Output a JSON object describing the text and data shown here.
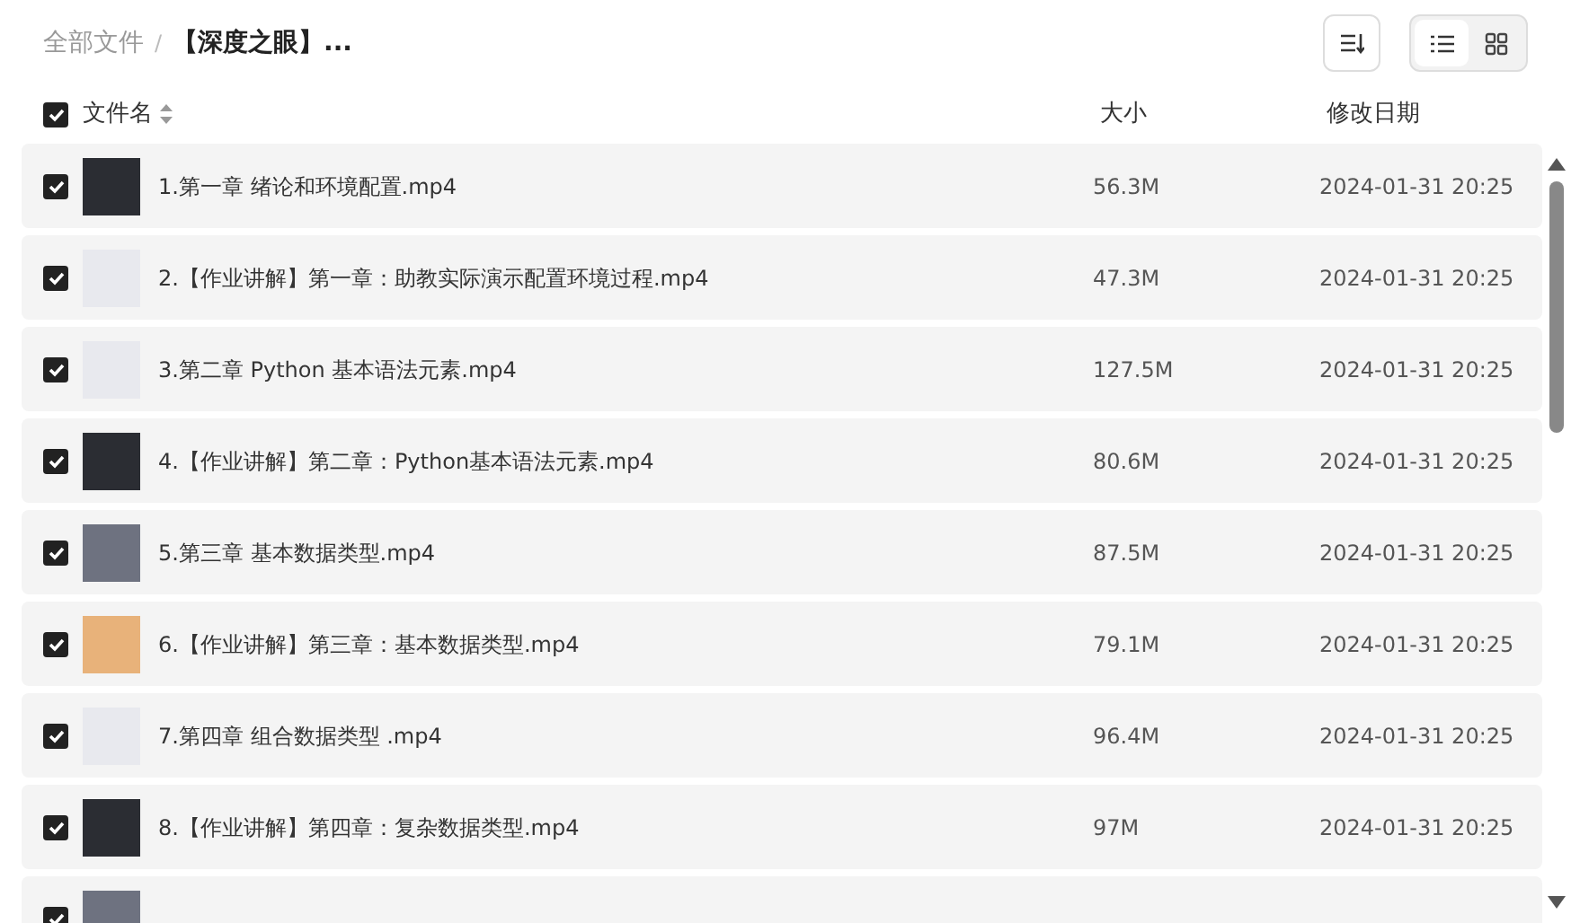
{
  "breadcrumb": [
    {
      "label": "全部文件",
      "current": false
    },
    {
      "label": "【深度之眼】...",
      "current": true
    }
  ],
  "breadcrumb_separator": "/",
  "view_buttons": [
    {
      "kind": "list",
      "selected": true
    },
    {
      "kind": "grid",
      "selected": false
    }
  ],
  "header": {
    "checked": true,
    "name": "文件名",
    "size": "大小",
    "date": "修改日期"
  },
  "files": [
    {
      "checked": true,
      "kind": "dark",
      "name": "1.第一章 绪论和环境配置.mp4",
      "size": "56.3M",
      "date": "2024-01-31 20:25"
    },
    {
      "checked": true,
      "kind": "light",
      "name": "2.【作业讲解】第一章：助教实际演示配置环境过程.mp4",
      "size": "47.3M",
      "date": "2024-01-31 20:25"
    },
    {
      "checked": true,
      "kind": "light",
      "name": "3.第二章 Python 基本语法元素.mp4",
      "size": "127.5M",
      "date": "2024-01-31 20:25"
    },
    {
      "checked": true,
      "kind": "dark",
      "name": "4.【作业讲解】第二章：Python基本语法元素.mp4",
      "size": "80.6M",
      "date": "2024-01-31 20:25"
    },
    {
      "checked": true,
      "kind": "grey",
      "name": "5.第三章 基本数据类型.mp4",
      "size": "87.5M",
      "date": "2024-01-31 20:25"
    },
    {
      "checked": true,
      "kind": "warm",
      "name": "6.【作业讲解】第三章：基本数据类型.mp4",
      "size": "79.1M",
      "date": "2024-01-31 20:25"
    },
    {
      "checked": true,
      "kind": "light",
      "name": "7.第四章 组合数据类型 .mp4",
      "size": "96.4M",
      "date": "2024-01-31 20:25"
    },
    {
      "checked": true,
      "kind": "dark",
      "name": "8.【作业讲解】第四章：复杂数据类型.mp4",
      "size": "97M",
      "date": "2024-01-31 20:25"
    },
    {
      "checked": true,
      "kind": "grey"
    }
  ]
}
